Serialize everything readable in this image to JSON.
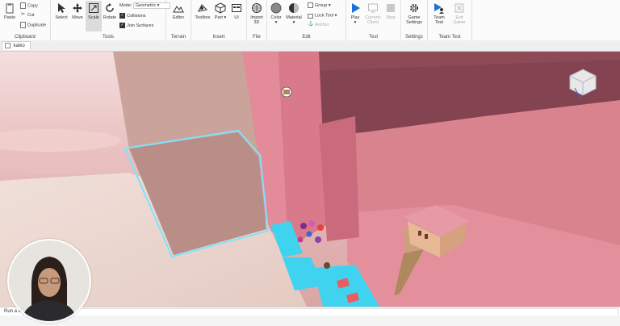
{
  "ribbon": {
    "clipboard": {
      "label": "Clipboard",
      "paste": "Paste",
      "copy": "Copy",
      "cut": "Cut",
      "duplicate": "Duplicate"
    },
    "tools": {
      "label": "Tools",
      "select": "Select",
      "move": "Move",
      "scale": "Scale",
      "rotate": "Rotate",
      "mode_label": "Mode:",
      "mode_value": "Geometric",
      "collisions": "Collisions",
      "join_surfaces": "Join Surfaces"
    },
    "terrain": {
      "label": "Terrain",
      "editor": "Editor"
    },
    "insert": {
      "label": "Insert",
      "toolbox": "Toolbox",
      "part": "Part",
      "ui": "UI"
    },
    "file": {
      "label": "File",
      "import3d_line1": "Import",
      "import3d_line2": "3D"
    },
    "edit": {
      "label": "Edit",
      "color": "Color",
      "material": "Material",
      "group": "Group",
      "lock_tool": "Lock Tool",
      "anchor": "Anchor"
    },
    "test": {
      "label": "Test",
      "play": "Play",
      "current_line1": "Current:",
      "current_line2": "Client",
      "stop": "Stop"
    },
    "settings": {
      "label": "Settings",
      "game_line1": "Game",
      "game_line2": "Settings"
    },
    "team_test": {
      "label": "Team Test",
      "team_line1": "Team",
      "team_line2": "Test",
      "exit_line1": "Exit",
      "exit_line2": "Game"
    }
  },
  "tab": {
    "name": "kaiko",
    "close": "×"
  },
  "command_bar": {
    "label": "Run a command"
  },
  "colors": {
    "sky": "#e8bcbc",
    "pink_wall": "#d8788a",
    "cyan_highlight": "#3fd3f0",
    "accent_blue": "#1f6fd6"
  }
}
